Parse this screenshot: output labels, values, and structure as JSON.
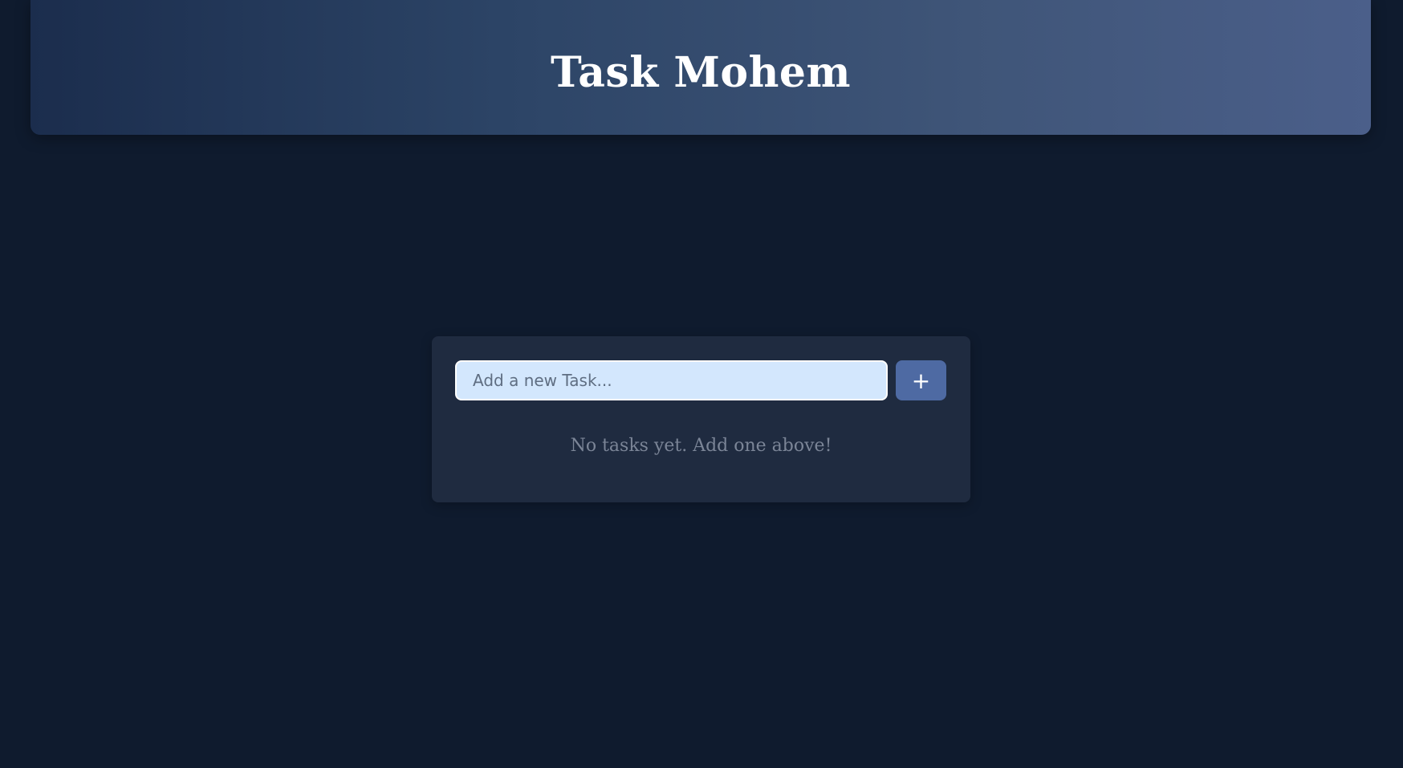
{
  "header": {
    "title": "Task Mohem"
  },
  "task_form": {
    "input_value": "",
    "input_placeholder": "Add a new Task...",
    "add_button_label": "+"
  },
  "task_list": {
    "empty_message": "No tasks yet. Add one above!"
  },
  "colors": {
    "background": "#0f1b2e",
    "card": "#1f2b40",
    "input_bg": "#d3e7fd",
    "button": "#4e6aa3",
    "header_gradient_start": "#1b2d4d",
    "header_gradient_end": "#4b5f8a"
  }
}
